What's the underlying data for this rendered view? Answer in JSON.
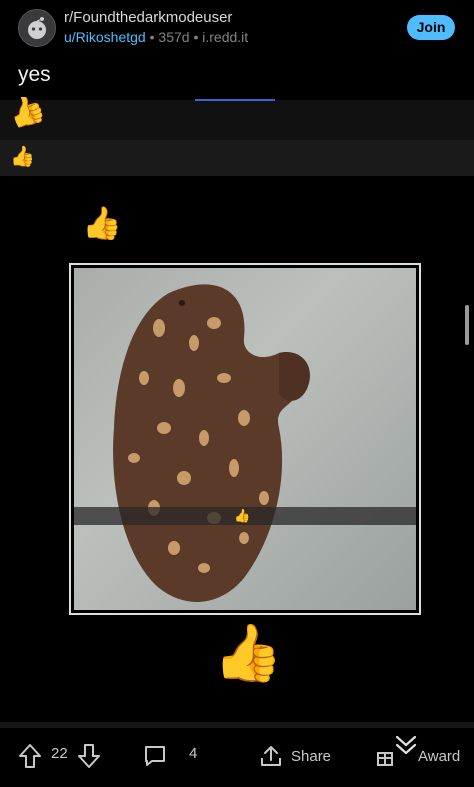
{
  "header": {
    "subreddit": "r/Foundthedarkmodeuser",
    "username": "u/Rikoshetgd",
    "age": "357d",
    "domain": "i.redd.it",
    "join_label": "Join"
  },
  "post": {
    "title": "yes"
  },
  "image": {
    "emojis": [
      "👍",
      "👍",
      "👍",
      "👍",
      "👍"
    ]
  },
  "footer": {
    "score": "22",
    "comments": "4",
    "share_label": "Share",
    "award_label": "Award"
  },
  "colors": {
    "accent": "#4fbcff",
    "background": "#000000"
  },
  "icons": [
    "reddit-alien-avatar-icon",
    "upvote-arrow-icon",
    "downvote-arrow-icon",
    "comment-bubble-icon",
    "share-icon",
    "award-icon",
    "chevron-down-icon"
  ]
}
